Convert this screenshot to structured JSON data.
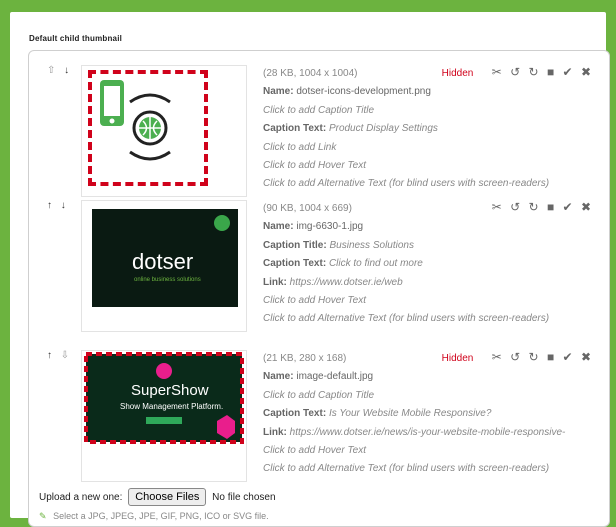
{
  "section": {
    "title": "Default child thumbnail"
  },
  "items": [
    {
      "size": "(28 KB, 1004 x 1004)",
      "hidden": "Hidden",
      "name_label": "Name:",
      "name": "dotser-icons-development.png",
      "caption_title": "Click to add Caption Title",
      "caption_text_label": "Caption Text:",
      "caption_text": "Product Display Settings",
      "link": "Click to add Link",
      "hover": "Click to add Hover Text",
      "alt": "Click to add Alternative Text (for blind users with screen-readers)"
    },
    {
      "size": "(90 KB, 1004 x 669)",
      "name_label": "Name:",
      "name": "img-6630-1.jpg",
      "caption_title_label": "Caption Title:",
      "caption_title": "Business Solutions",
      "caption_text_label": "Caption Text:",
      "caption_text": "Click to find out more",
      "link_label": "Link:",
      "link": "https://www.dotser.ie/web",
      "hover": "Click to add Hover Text",
      "alt": "Click to add Alternative Text (for blind users with screen-readers)",
      "thumb_brand": "dotser",
      "thumb_tagline": "online business solutions"
    },
    {
      "size": "(21 KB, 280 x 168)",
      "hidden": "Hidden",
      "name_label": "Name:",
      "name": "image-default.jpg",
      "caption_title": "Click to add Caption Title",
      "caption_text_label": "Caption Text:",
      "caption_text": "Is Your Website Mobile Responsive?",
      "link_label": "Link:",
      "link": "https://www.dotser.ie/news/is-your-website-mobile-responsive-",
      "hover": "Click to add Hover Text",
      "alt": "Click to add Alternative Text (for blind users with screen-readers)",
      "thumb_brand": "SuperShow",
      "thumb_tagline": "Show Management Platform."
    }
  ],
  "upload": {
    "label": "Upload a new one:",
    "button": "Choose Files",
    "status": "No file chosen",
    "hint": "Select a JPG, JPEG, JPE, GIF, PNG, ICO or SVG file."
  },
  "colors": {
    "accent": "#6cb33f",
    "hidden": "#d0021b"
  }
}
